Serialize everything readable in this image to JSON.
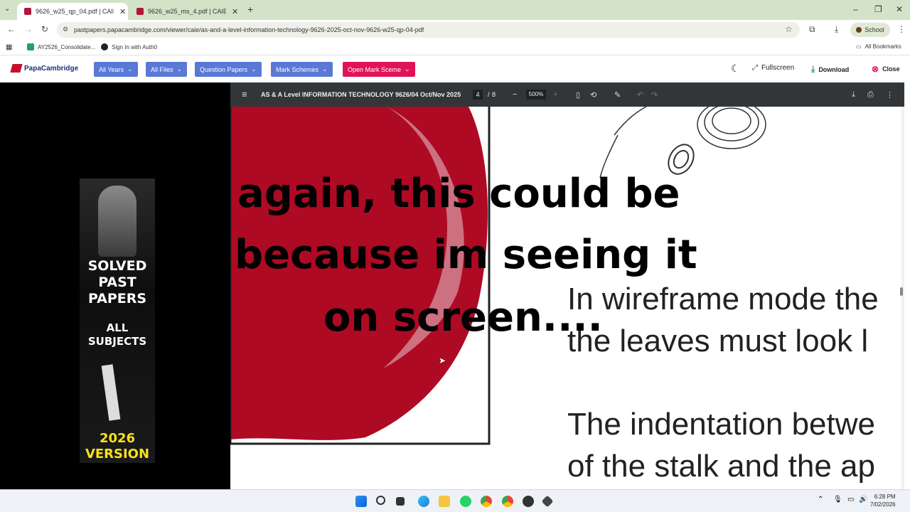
{
  "browser": {
    "tabs": [
      {
        "title": "9626_w25_qp_04.pdf | CAIE | Pa"
      },
      {
        "title": "9626_w25_ms_4.pdf | CAIE | Pa"
      }
    ],
    "url": "pastpapers.papacambridge.com/viewer/caie/as-and-a-level-information-technology-9626-2025-oct-nov-9626-w25-qp-04-pdf",
    "profile_label": "School",
    "bookmarks": [
      "AY2526_Consolidate...",
      "Sign In with Auth0"
    ],
    "all_bookmarks": "All Bookmarks"
  },
  "site": {
    "logo": "PapaCambridge",
    "nav": [
      "All Years",
      "All Files",
      "Question Papers",
      "Mark Schemes"
    ],
    "open_mark_scheme": "Open Mark Sceme",
    "fullscreen": "Fullscreen",
    "download": "Download",
    "close": "Close"
  },
  "ad": {
    "line1": "SOLVED",
    "line2": "PAST",
    "line3": "PAPERS",
    "line4": "ALL",
    "line5": "SUBJECTS",
    "line6": "2026",
    "line7": "VERSION"
  },
  "pdf": {
    "title": "AS & A Level INFORMATION TECHNOLOGY 9626/04 Oct/Nov 2025",
    "page": "4",
    "page_sep": "/",
    "total_pages": "8",
    "zoom": "500%",
    "text_line1": "In wireframe mode the",
    "text_line2": "the leaves must look l",
    "text_line3": "The indentation betwe",
    "text_line4": "of the stalk and the ap"
  },
  "caption": {
    "line1": "again, this could be",
    "line2": "because im seeing it",
    "line3": "on screen...."
  },
  "clock": {
    "time": "6:28 PM",
    "date": "7/02/2026"
  },
  "colors": {
    "apple_red": "#ae0a24",
    "nav_blue": "#5a79d6",
    "nav_pink": "#e0135a"
  }
}
